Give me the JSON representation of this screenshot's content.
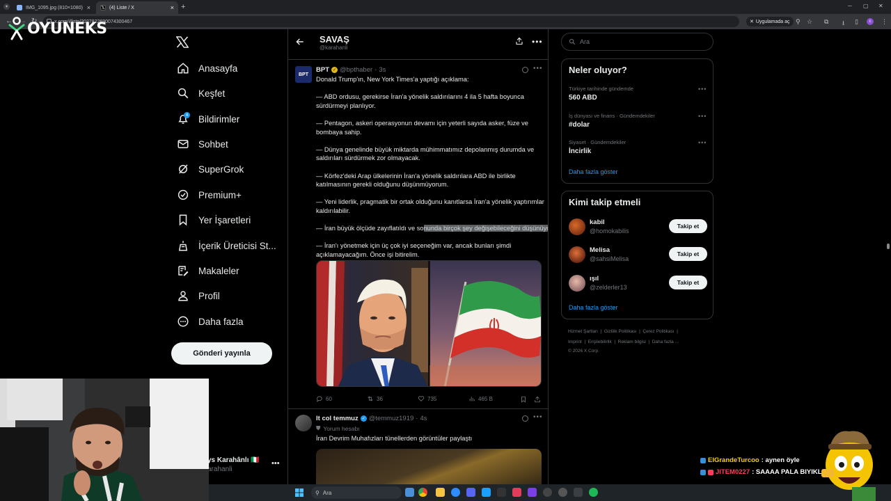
{
  "browser": {
    "tabs": [
      {
        "title": "IMG_1095.jpg (810×1080)",
        "active": false
      },
      {
        "title": "(4) Liste / X",
        "active": true
      }
    ],
    "new_tab": "+",
    "url": "x.com/i/lists/2027822690074300467",
    "open_in_app": "Uygulamada aç",
    "profile_initial": "c"
  },
  "overlay_logo": "OYUNEKS",
  "nav": {
    "items": [
      {
        "label": "Anasayfa",
        "icon": "home-icon"
      },
      {
        "label": "Keşfet",
        "icon": "search-icon"
      },
      {
        "label": "Bildirimler",
        "icon": "bell-icon",
        "badge": "4"
      },
      {
        "label": "Sohbet",
        "icon": "mail-icon"
      },
      {
        "label": "SuperGrok",
        "icon": "grok-icon"
      },
      {
        "label": "Premium+",
        "icon": "premium-icon"
      },
      {
        "label": "Yer İşaretleri",
        "icon": "bookmark-icon"
      },
      {
        "label": "İçerik Üreticisi St...",
        "icon": "creator-studio-icon"
      },
      {
        "label": "Makaleler",
        "icon": "article-icon"
      },
      {
        "label": "Profil",
        "icon": "profile-icon"
      },
      {
        "label": "Daha fazla",
        "icon": "more-icon"
      }
    ],
    "post_button": "Gönderi yayınla",
    "account": {
      "name": "ys Karahânlı 🇮🇹",
      "handle": "arahanli"
    }
  },
  "list": {
    "title": "SAVAŞ",
    "handle": "@karahanli"
  },
  "tweets": [
    {
      "name": "BPT",
      "handle": "@bpthaber",
      "time": "3s",
      "avatar_text": "BPT",
      "paragraphs": [
        "Donald Trump'ın, New York Times'a yaptığı açıklama:",
        "— ABD ordusu, gerekirse İran'a yönelik saldırılarını 4 ila 5 hafta boyunca sürdürmeyi planlıyor.",
        "— Pentagon, askeri operasyonun devamı için yeterli sayıda asker, füze ve bombaya sahip.",
        "— Dünya genelinde büyük miktarda mühimmatımız depolanmış durumda ve saldırıları sürdürmek zor olmayacak.",
        "— Körfez'deki Arap ülkelerinin İran'a yönelik saldırılara ABD ile birlikte katılmasının gerekli olduğunu düşünmüyorum.",
        "— Yeni liderlik, pragmatik bir ortak olduğunu kanıtlarsa İran'a yönelik yaptırımlar kaldırılabilir."
      ],
      "highlight_plain": "— İran büyük ölçüde zayıflatıldı ve so",
      "highlight_marked": "nunda birçok şey değişebileceğini düşünüyorum.",
      "last_paragraph": "— İran'ı yönetmek için üç çok iyi seçeneğim var, ancak bunları şimdi açıklamayacağım. Önce işi bitirelim.",
      "stats": {
        "replies": "60",
        "reposts": "36",
        "likes": "735",
        "views": "465 B"
      }
    },
    {
      "name": "lt col temmuz",
      "handle": "@temmuz1919",
      "time": "4s",
      "label": "Yorum hesabı",
      "text": "İran Devrim Muhafızları tünellerden görüntüler paylaştı"
    }
  ],
  "search": {
    "placeholder": "Ara"
  },
  "trends": {
    "title": "Neler oluyor?",
    "items": [
      {
        "category": "Türkiye tarihinde gündemde",
        "name": "560 ABD"
      },
      {
        "category": "İş dünyası ve finans · Gündemdekiler",
        "name": "#dolar"
      },
      {
        "category": "Siyaset · Gündemdekiler",
        "name": "İncirlik"
      }
    ],
    "show_more": "Daha fazla göster"
  },
  "who_to_follow": {
    "title": "Kimi takip etmeli",
    "items": [
      {
        "name": "kabil",
        "handle": "@homokabilis",
        "button": "Takip et"
      },
      {
        "name": "Melisa",
        "handle": "@sahsiMelisa",
        "button": "Takip et"
      },
      {
        "name": "ışıl",
        "handle": "@zelderler13",
        "button": "Takip et"
      }
    ],
    "show_more": "Daha fazla göster"
  },
  "footer": {
    "line1": [
      "Hizmet Şartları",
      "Gizlilik Politikası",
      "Çerez Politikası"
    ],
    "line2": [
      "Imprint",
      "Erişilebilirlik",
      "Reklam bilgisi",
      "Daha fazla ..."
    ],
    "copyright": "© 2026 X Corp."
  },
  "chat": [
    {
      "user": "ElGrandeTurcoo",
      "message": ": aynen öyle",
      "color": "#f5d000"
    },
    {
      "user": "JITEM0227",
      "message": ": SAAAA PALA BIYIKLI CAZIBESI",
      "color": "#ff3d5a"
    }
  ],
  "taskbar": {
    "search_placeholder": "Ara"
  },
  "colors": {
    "accent": "#1d9bf0",
    "verified_gold": "#e2b719",
    "border": "#2f3336",
    "muted": "#71767b"
  }
}
